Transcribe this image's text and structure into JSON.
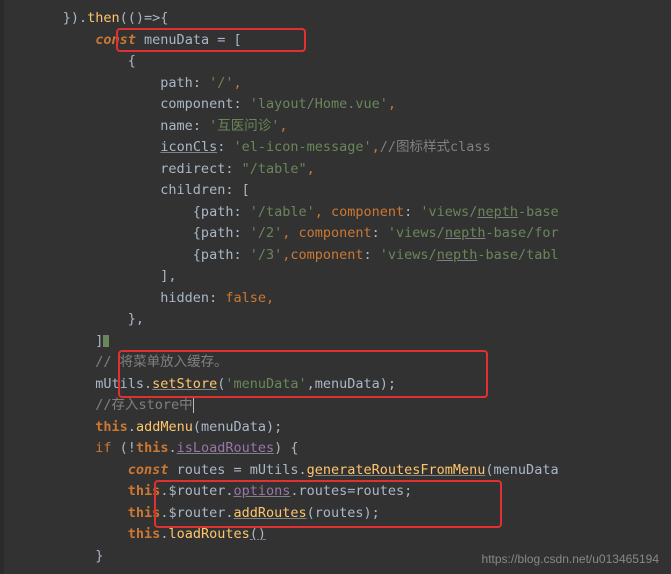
{
  "code": {
    "l1_a": "      }).",
    "l1_then": "then",
    "l1_b": "(()=>{",
    "l2_a": "          ",
    "l2_const": "const",
    "l2_b": " menuData = [",
    "l3": "              {",
    "l4_a": "                  path",
    "l4_b": ": ",
    "l4_c": "'/'",
    "l4_d": ",",
    "l5_a": "                  component",
    "l5_b": ": ",
    "l5_c": "'layout/Home.vue'",
    "l5_d": ",",
    "l6_a": "                  name",
    "l6_b": ": ",
    "l6_c": "'互医问诊'",
    "l6_d": ",",
    "l7_a": "                  ",
    "l7_b": "iconCls",
    "l7_c": ": ",
    "l7_d": "'el-icon-message'",
    "l7_e": ",",
    "l7_f": "//图标样式class",
    "l8_a": "                  redirect",
    "l8_b": ": ",
    "l8_c": "\"/table\"",
    "l8_d": ",",
    "l9_a": "                  children",
    "l9_b": ": [",
    "l10_a": "                      {path",
    "l10_b": ": ",
    "l10_c": "'/table'",
    "l10_d": ", component",
    "l10_e": ": ",
    "l10_f": "'views/",
    "l10_g": "nepth",
    "l10_h": "-base",
    "l11_a": "                      {path",
    "l11_b": ": ",
    "l11_c": "'/2'",
    "l11_d": ", component",
    "l11_e": ": ",
    "l11_f": "'views/",
    "l11_g": "nepth",
    "l11_h": "-base/for",
    "l12_a": "                      {path",
    "l12_b": ": ",
    "l12_c": "'/3'",
    "l12_d": ",component",
    "l12_e": ": ",
    "l12_f": "'views/",
    "l12_g": "nepth",
    "l12_h": "-base/tabl",
    "l13": "                  ],",
    "l14_a": "                  hidden",
    "l14_b": ": ",
    "l14_c": "false",
    "l14_d": ",",
    "l15": "              },",
    "l16a": "          ]",
    "l17": "          // 将菜单放入缓存。",
    "l18_a": "          mUtils.",
    "l18_b": "setStore",
    "l18_c": "(",
    "l18_d": "'menuData'",
    "l18_e": ",menuData);",
    "l19": "          //存入store中",
    "l20_a": "          ",
    "l20_this": "this",
    "l20_b": ".",
    "l20_c": "addMenu",
    "l20_d": "(menuData);",
    "l21_a": "          ",
    "l21_if": "if",
    "l21_b": " (!",
    "l21_this": "this",
    "l21_c": ".",
    "l21_d": "isLoadRoutes",
    "l21_e": ") {",
    "l22_a": "              ",
    "l22_const": "const",
    "l22_b": " routes = mUtils.",
    "l22_c": "generateRoutesFromMenu",
    "l22_d": "(menuData",
    "l23_a": "              ",
    "l23_this": "this",
    "l23_b": ".$router.",
    "l23_c": "options",
    "l23_d": ".routes=routes;",
    "l24_a": "              ",
    "l24_this": "this",
    "l24_b": ".$router.",
    "l24_c": "addRoutes",
    "l24_d": "(routes);",
    "l25_a": "              ",
    "l25_this": "this",
    "l25_b": ".",
    "l25_c": "loadRoutes",
    "l25_d": "()",
    "l26": "          }"
  },
  "watermark": "https://blog.csdn.net/u013465194"
}
